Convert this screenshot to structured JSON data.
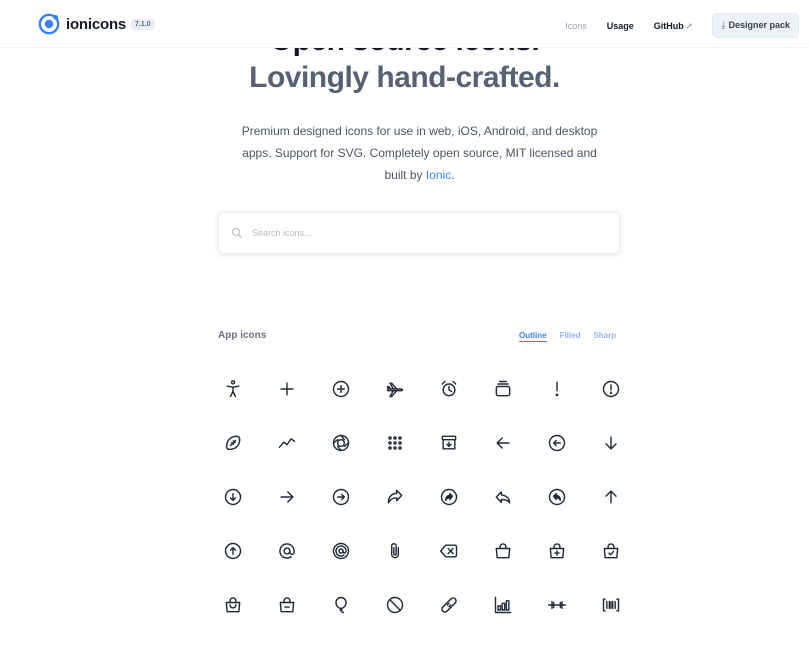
{
  "header": {
    "logo_text": "ionicons",
    "version": "7.1.0",
    "nav": {
      "icons": "Icons",
      "usage": "Usage",
      "github": "GitHub",
      "github_ext": "↗",
      "designer_pack": "Designer pack",
      "download_glyph": "⤓"
    },
    "accent_color": "#3880ff"
  },
  "hero": {
    "title_line1": "Open source icons.",
    "title_line2": "Lovingly hand-crafted.",
    "description": "Premium designed icons for use in web, iOS, Android, and desktop apps. Support for SVG. Completely open source, MIT licensed and built by ",
    "link_text": "Ionic",
    "description_end": "."
  },
  "search": {
    "placeholder": "Search icons..."
  },
  "section": {
    "title": "App icons",
    "tabs": [
      "Outline",
      "Filled",
      "Sharp"
    ],
    "active_tab": "Outline"
  },
  "icons": [
    "accessibility-icon",
    "add-icon",
    "add-circle-icon",
    "airplane-icon",
    "alarm-icon",
    "albums-icon",
    "alert-icon",
    "alert-circle-icon",
    "american-football-icon",
    "analytics-icon",
    "aperture-icon",
    "apps-icon",
    "archive-icon",
    "arrow-back-icon",
    "arrow-back-circle-icon",
    "arrow-down-icon",
    "arrow-down-circle-icon",
    "arrow-forward-icon",
    "arrow-forward-circle-icon",
    "arrow-redo-icon",
    "arrow-redo-circle-icon",
    "arrow-undo-icon",
    "arrow-undo-circle-icon",
    "arrow-up-icon",
    "arrow-up-circle-icon",
    "at-icon",
    "at-circle-icon",
    "attach-icon",
    "backspace-icon",
    "bag-icon",
    "bag-add-icon",
    "bag-check-icon",
    "bag-handle-icon",
    "bag-remove-icon",
    "balloon-icon",
    "ban-icon",
    "bandage-icon",
    "bar-chart-icon",
    "barbell-icon",
    "barcode-icon"
  ]
}
